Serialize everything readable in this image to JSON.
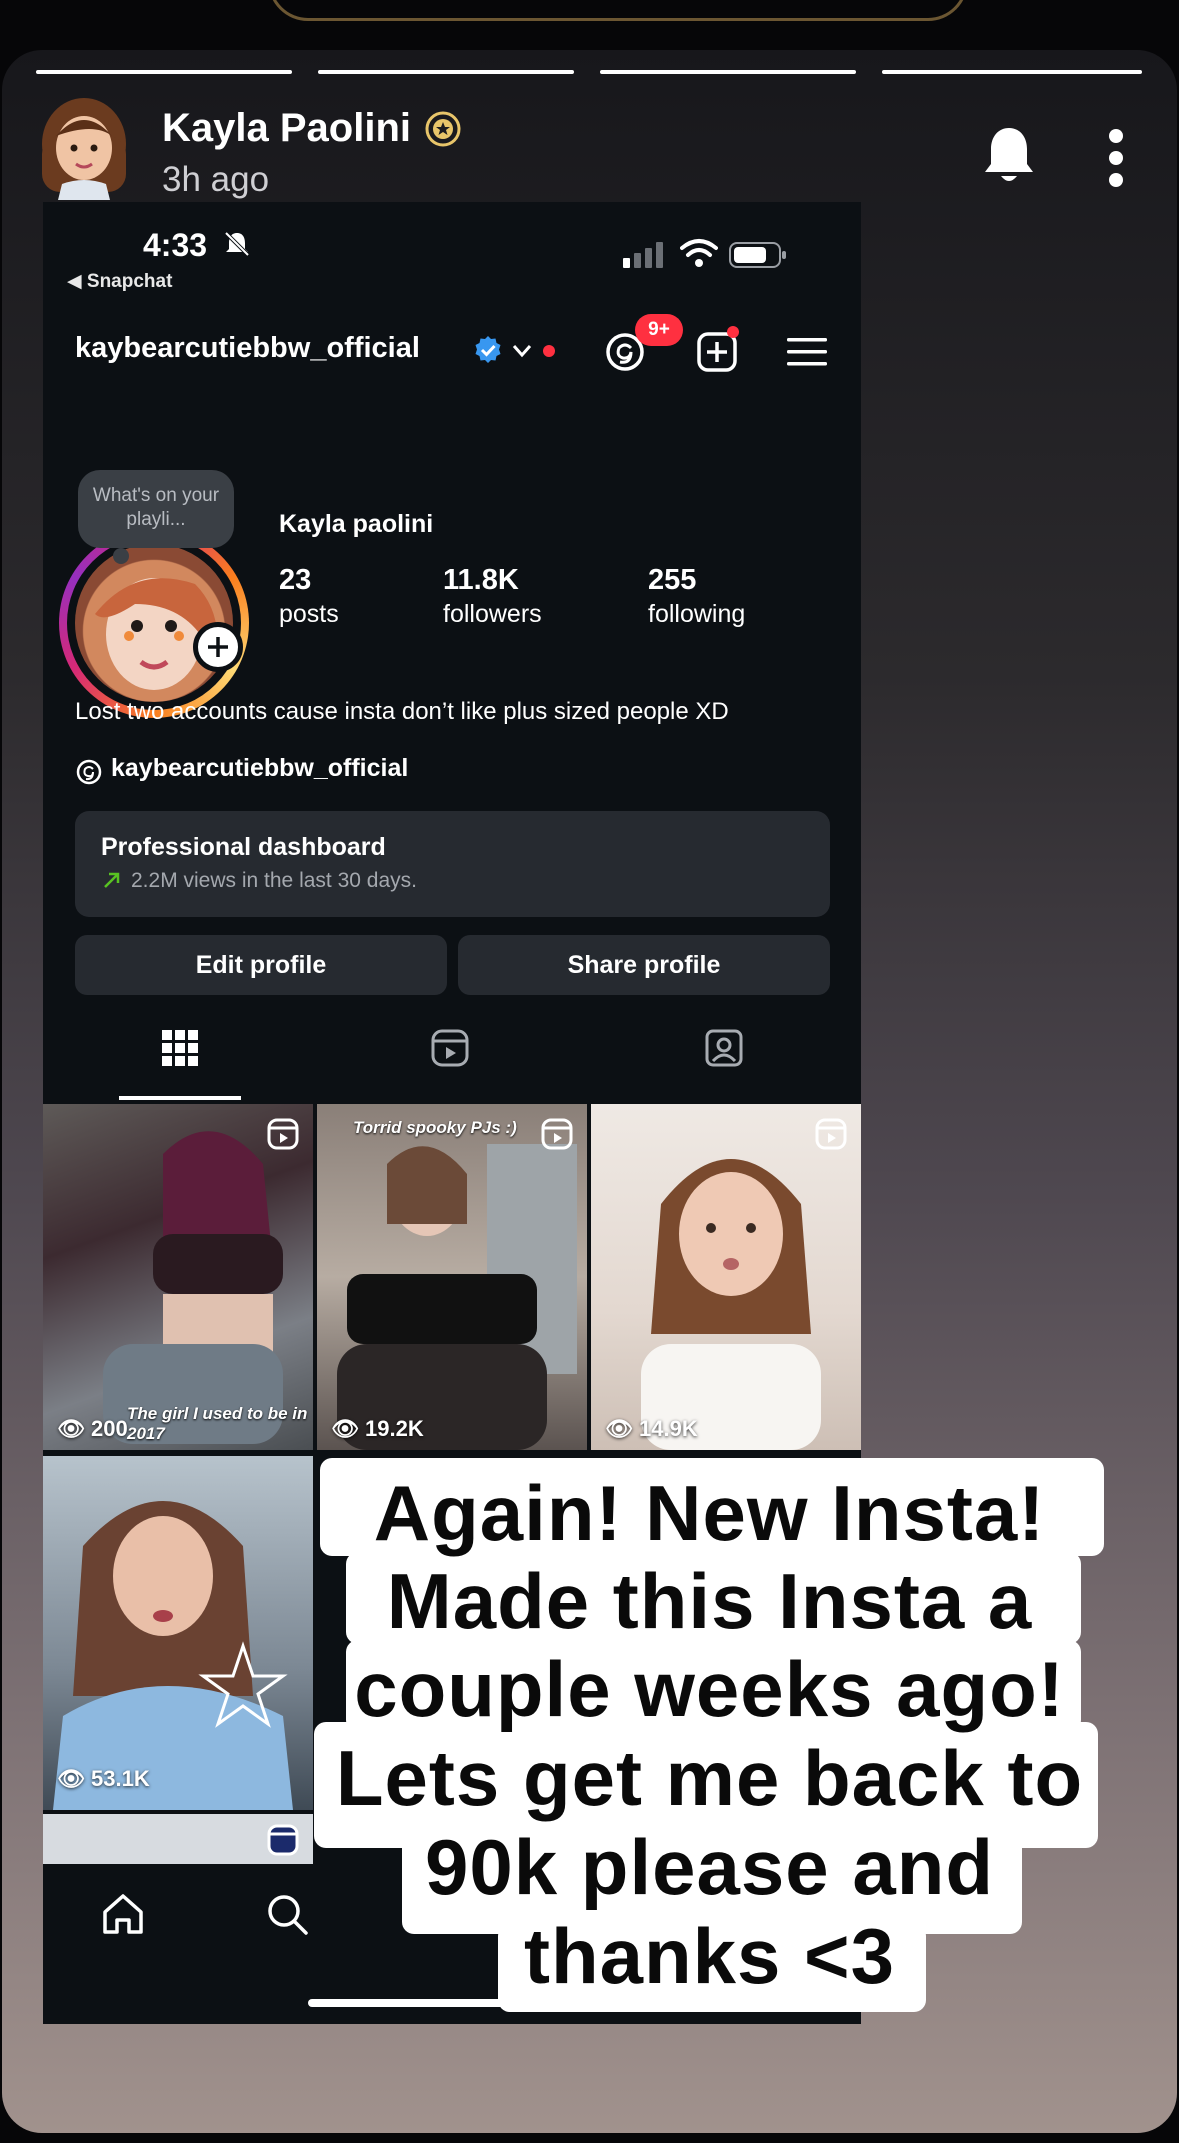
{
  "story": {
    "user_name": "Kayla Paolini",
    "time_ago": "3h ago",
    "progress_segments": 4
  },
  "instagram": {
    "status_bar": {
      "time": "4:33",
      "back_label": "◀ Snapchat"
    },
    "handle": "kaybearcutiebbw_official",
    "notification_badge": "9+",
    "note_text": "What's on your playli...",
    "display_name": "Kayla paolini",
    "stats": {
      "posts": {
        "value": "23",
        "label": "posts"
      },
      "followers": {
        "value": "11.8K",
        "label": "followers"
      },
      "following": {
        "value": "255",
        "label": "following"
      }
    },
    "bio": "Lost two accounts cause insta don’t like plus sized people XD",
    "threads_link": "kaybearcutiebbw_official",
    "dashboard": {
      "title": "Professional dashboard",
      "subtitle": "2.2M views in the last 30 days."
    },
    "buttons": {
      "edit": "Edit profile",
      "share": "Share profile"
    },
    "posts": [
      {
        "views": "200",
        "caption": "The girl I used to be in 2017"
      },
      {
        "views": "19.2K",
        "caption": "Torrid spooky PJs :)"
      },
      {
        "views": "14.9K",
        "caption": ""
      },
      {
        "views": "53.1K",
        "caption": ""
      }
    ]
  },
  "overlay_text": {
    "lines": [
      "Again! New Insta!",
      "Made this Insta a",
      "couple weeks ago!",
      "Lets get me back to",
      "90k please and",
      "thanks <3"
    ]
  },
  "colors": {
    "verified_blue": "#3897f0",
    "notification_red": "#ff3040",
    "bitmoji_badge": "#e8c56a"
  }
}
